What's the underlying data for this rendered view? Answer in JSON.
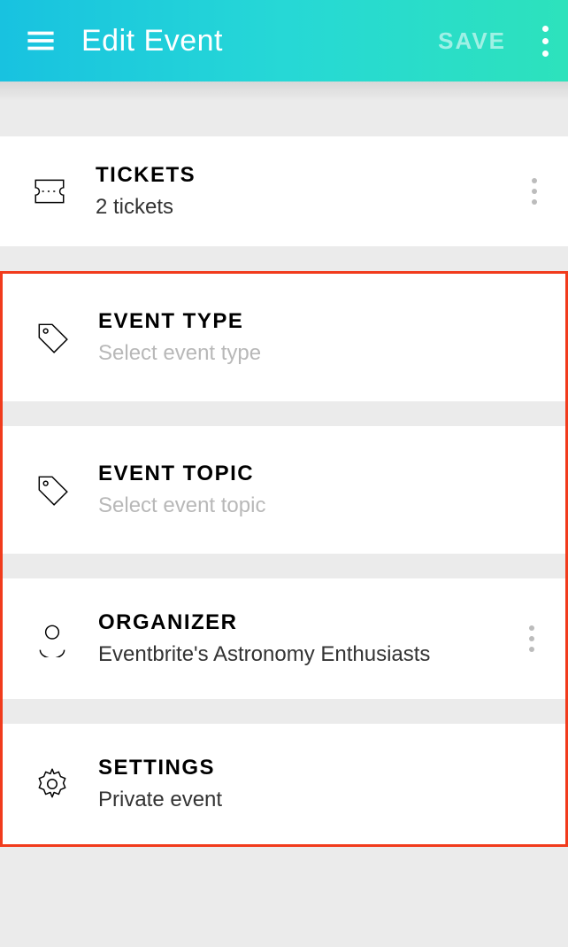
{
  "header": {
    "title": "Edit Event",
    "save_label": "SAVE"
  },
  "tickets": {
    "title": "TICKETS",
    "value": "2 tickets"
  },
  "event_type": {
    "title": "EVENT TYPE",
    "placeholder": "Select event type"
  },
  "event_topic": {
    "title": "EVENT TOPIC",
    "placeholder": "Select event topic"
  },
  "organizer": {
    "title": "ORGANIZER",
    "value": "Eventbrite's Astronomy Enthusiasts"
  },
  "settings": {
    "title": "SETTINGS",
    "value": "Private event"
  }
}
